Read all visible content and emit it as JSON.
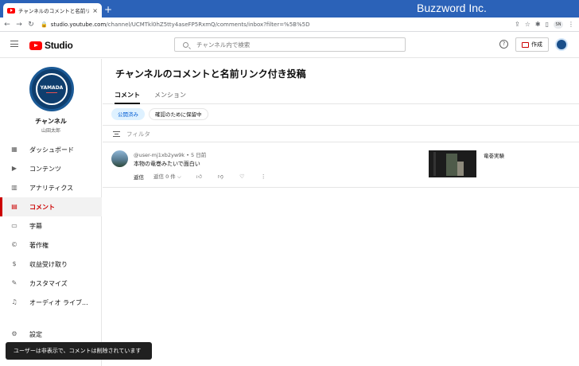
{
  "browser": {
    "tab_title": "チャンネルのコメントと名前リンク付き",
    "tab_close": "×",
    "new_tab": "+",
    "brand": "Buzzword Inc.",
    "url_host": "studio.youtube.com",
    "url_path": "/channel/UCMTkl0hZ5tty4aseFP5RxmQ/comments/inbox?filter=%5B%5D",
    "profile": "SN"
  },
  "header": {
    "logo_text": "Studio",
    "search_placeholder": "チャンネル内で検索",
    "help": "?",
    "create_label": "作成"
  },
  "sidebar": {
    "avatar_text": "YAMADA",
    "channel_label": "チャンネル",
    "channel_name": "山田太郎",
    "items": [
      {
        "label": "ダッシュボード",
        "icon": "dashboard-icon",
        "glyph": "▦"
      },
      {
        "label": "コンテンツ",
        "icon": "content-icon",
        "glyph": "▶"
      },
      {
        "label": "アナリティクス",
        "icon": "analytics-icon",
        "glyph": "▥"
      },
      {
        "label": "コメント",
        "icon": "comments-icon",
        "glyph": "▤"
      },
      {
        "label": "字幕",
        "icon": "subtitles-icon",
        "glyph": "▭"
      },
      {
        "label": "著作権",
        "icon": "copyright-icon",
        "glyph": "©"
      },
      {
        "label": "収益受け取り",
        "icon": "monetization-icon",
        "glyph": "$"
      },
      {
        "label": "カスタマイズ",
        "icon": "customize-icon",
        "glyph": "✎"
      },
      {
        "label": "オーディオ ライブ...",
        "icon": "audio-library-icon",
        "glyph": "♫"
      }
    ],
    "settings_label": "設定",
    "settings_glyph": "⚙"
  },
  "main": {
    "title": "チャンネルのコメントと名前リンク付き投稿",
    "tabs": [
      "コメント",
      "メンション"
    ],
    "chips": [
      "公開済み",
      "確認のために保留中"
    ],
    "filter_label": "フィルタ"
  },
  "comments": [
    {
      "author": "@user-mj1xb2yw9k",
      "time": "5 日前",
      "text": "本物の竜巻みたいで面白い",
      "reply_label": "返信",
      "replies": "返信 0 件 ⌵",
      "video_title": "竜巻実験"
    }
  ],
  "toast": "ユーザーは非表示で、コメントは削除されています"
}
